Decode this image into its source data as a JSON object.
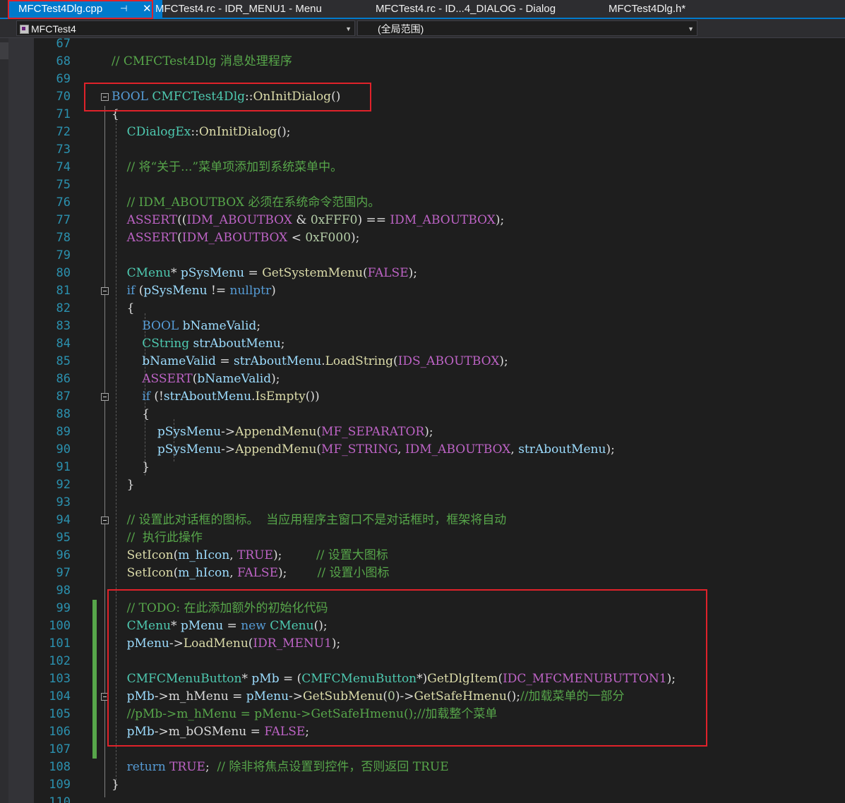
{
  "tabs": [
    {
      "label": "MFCTest4Dlg.cpp",
      "active": true
    },
    {
      "label": "MFCTest4.rc - IDR_MENU1 - Menu"
    },
    {
      "label": "MFCTest4.rc - ID...4_DIALOG - Dialog"
    },
    {
      "label": "MFCTest4Dlg.h*"
    }
  ],
  "tab_pin_icon": "pin-icon",
  "tab_close_icon": "close-icon",
  "project_dropdown": {
    "value": "MFCTest4",
    "icon": "cpp-project-icon"
  },
  "scope_dropdown": {
    "value": "(全局范围)"
  },
  "colors": {
    "accent": "#007acc",
    "highlight_box": "#e0222a",
    "keyword": "#569cd6",
    "type": "#4ec9b0",
    "comment": "#57a64a",
    "function": "#dcdcaa",
    "macro": "#bd63c5",
    "variable": "#9cdcfe",
    "number": "#b5cea8",
    "line_number": "#2b91af",
    "change_bar": "#57a64a"
  },
  "lines": [
    {
      "n": "67",
      "t": [
        [
          "df",
          ""
        ]
      ]
    },
    {
      "n": "68",
      "t": [
        [
          "cm",
          "// CMFCTest4Dlg 消息处理程序"
        ]
      ]
    },
    {
      "n": "69",
      "t": [
        [
          "df",
          ""
        ]
      ]
    },
    {
      "n": "70",
      "t": [
        [
          "kw",
          "BOOL"
        ],
        [
          "df",
          " "
        ],
        [
          "ty",
          "CMFCTest4Dlg"
        ],
        [
          "df",
          "::"
        ],
        [
          "fn",
          "OnInitDialog"
        ],
        [
          "df",
          "()"
        ]
      ]
    },
    {
      "n": "71",
      "t": [
        [
          "df",
          "{"
        ]
      ]
    },
    {
      "n": "72",
      "t": [
        [
          "df",
          "    "
        ],
        [
          "ty",
          "CDialogEx"
        ],
        [
          "df",
          "::"
        ],
        [
          "fn",
          "OnInitDialog"
        ],
        [
          "df",
          "();"
        ]
      ]
    },
    {
      "n": "73",
      "t": [
        [
          "df",
          ""
        ]
      ]
    },
    {
      "n": "74",
      "t": [
        [
          "df",
          "    "
        ],
        [
          "cm",
          "// 将“关于...”菜单项添加到系统菜单中。"
        ]
      ]
    },
    {
      "n": "75",
      "t": [
        [
          "df",
          ""
        ]
      ]
    },
    {
      "n": "76",
      "t": [
        [
          "df",
          "    "
        ],
        [
          "cm",
          "// IDM_ABOUTBOX 必须在系统命令范围内。"
        ]
      ]
    },
    {
      "n": "77",
      "t": [
        [
          "df",
          "    "
        ],
        [
          "mc",
          "ASSERT"
        ],
        [
          "df",
          "(("
        ],
        [
          "mc",
          "IDM_ABOUTBOX"
        ],
        [
          "df",
          " & "
        ],
        [
          "nm",
          "0xFFF0"
        ],
        [
          "df",
          ") == "
        ],
        [
          "mc",
          "IDM_ABOUTBOX"
        ],
        [
          "df",
          ");"
        ]
      ]
    },
    {
      "n": "78",
      "t": [
        [
          "df",
          "    "
        ],
        [
          "mc",
          "ASSERT"
        ],
        [
          "df",
          "("
        ],
        [
          "mc",
          "IDM_ABOUTBOX"
        ],
        [
          "df",
          " < "
        ],
        [
          "nm",
          "0xF000"
        ],
        [
          "df",
          ");"
        ]
      ]
    },
    {
      "n": "79",
      "t": [
        [
          "df",
          ""
        ]
      ]
    },
    {
      "n": "80",
      "t": [
        [
          "df",
          "    "
        ],
        [
          "ty",
          "CMenu"
        ],
        [
          "df",
          "* "
        ],
        [
          "vr",
          "pSysMenu"
        ],
        [
          "df",
          " = "
        ],
        [
          "fn",
          "GetSystemMenu"
        ],
        [
          "df",
          "("
        ],
        [
          "mc",
          "FALSE"
        ],
        [
          "df",
          ");"
        ]
      ]
    },
    {
      "n": "81",
      "t": [
        [
          "df",
          "    "
        ],
        [
          "kw",
          "if"
        ],
        [
          "df",
          " ("
        ],
        [
          "vr",
          "pSysMenu"
        ],
        [
          "df",
          " != "
        ],
        [
          "kw",
          "nullptr"
        ],
        [
          "df",
          ")"
        ]
      ]
    },
    {
      "n": "82",
      "t": [
        [
          "df",
          "    {"
        ]
      ]
    },
    {
      "n": "83",
      "t": [
        [
          "df",
          "        "
        ],
        [
          "kw",
          "BOOL"
        ],
        [
          "df",
          " "
        ],
        [
          "vr",
          "bNameValid"
        ],
        [
          "df",
          ";"
        ]
      ]
    },
    {
      "n": "84",
      "t": [
        [
          "df",
          "        "
        ],
        [
          "ty",
          "CString"
        ],
        [
          "df",
          " "
        ],
        [
          "vr",
          "strAboutMenu"
        ],
        [
          "df",
          ";"
        ]
      ]
    },
    {
      "n": "85",
      "t": [
        [
          "df",
          "        "
        ],
        [
          "vr",
          "bNameValid"
        ],
        [
          "df",
          " = "
        ],
        [
          "vr",
          "strAboutMenu"
        ],
        [
          "df",
          "."
        ],
        [
          "fn",
          "LoadString"
        ],
        [
          "df",
          "("
        ],
        [
          "mc",
          "IDS_ABOUTBOX"
        ],
        [
          "df",
          ");"
        ]
      ]
    },
    {
      "n": "86",
      "t": [
        [
          "df",
          "        "
        ],
        [
          "mc",
          "ASSERT"
        ],
        [
          "df",
          "("
        ],
        [
          "vr",
          "bNameValid"
        ],
        [
          "df",
          ");"
        ]
      ]
    },
    {
      "n": "87",
      "t": [
        [
          "df",
          "        "
        ],
        [
          "kw",
          "if"
        ],
        [
          "df",
          " (!"
        ],
        [
          "vr",
          "strAboutMenu"
        ],
        [
          "df",
          "."
        ],
        [
          "fn",
          "IsEmpty"
        ],
        [
          "df",
          "())"
        ]
      ]
    },
    {
      "n": "88",
      "t": [
        [
          "df",
          "        {"
        ]
      ]
    },
    {
      "n": "89",
      "t": [
        [
          "df",
          "            "
        ],
        [
          "vr",
          "pSysMenu"
        ],
        [
          "df",
          "->"
        ],
        [
          "fn",
          "AppendMenu"
        ],
        [
          "df",
          "("
        ],
        [
          "mc",
          "MF_SEPARATOR"
        ],
        [
          "df",
          ");"
        ]
      ]
    },
    {
      "n": "90",
      "t": [
        [
          "df",
          "            "
        ],
        [
          "vr",
          "pSysMenu"
        ],
        [
          "df",
          "->"
        ],
        [
          "fn",
          "AppendMenu"
        ],
        [
          "df",
          "("
        ],
        [
          "mc",
          "MF_STRING"
        ],
        [
          "df",
          ", "
        ],
        [
          "mc",
          "IDM_ABOUTBOX"
        ],
        [
          "df",
          ", "
        ],
        [
          "vr",
          "strAboutMenu"
        ],
        [
          "df",
          ");"
        ]
      ]
    },
    {
      "n": "91",
      "t": [
        [
          "df",
          "        }"
        ]
      ]
    },
    {
      "n": "92",
      "t": [
        [
          "df",
          "    }"
        ]
      ]
    },
    {
      "n": "93",
      "t": [
        [
          "df",
          ""
        ]
      ]
    },
    {
      "n": "94",
      "t": [
        [
          "df",
          "    "
        ],
        [
          "cm",
          "// 设置此对话框的图标。  当应用程序主窗口不是对话框时，框架将自动"
        ]
      ]
    },
    {
      "n": "95",
      "t": [
        [
          "df",
          "    "
        ],
        [
          "cm",
          "//  执行此操作"
        ]
      ]
    },
    {
      "n": "96",
      "t": [
        [
          "df",
          "    "
        ],
        [
          "fn",
          "SetIcon"
        ],
        [
          "df",
          "("
        ],
        [
          "vr",
          "m_hIcon"
        ],
        [
          "df",
          ", "
        ],
        [
          "mc",
          "TRUE"
        ],
        [
          "df",
          ");         "
        ],
        [
          "cm",
          "// 设置大图标"
        ]
      ]
    },
    {
      "n": "97",
      "t": [
        [
          "df",
          "    "
        ],
        [
          "fn",
          "SetIcon"
        ],
        [
          "df",
          "("
        ],
        [
          "vr",
          "m_hIcon"
        ],
        [
          "df",
          ", "
        ],
        [
          "mc",
          "FALSE"
        ],
        [
          "df",
          ");        "
        ],
        [
          "cm",
          "// 设置小图标"
        ]
      ]
    },
    {
      "n": "98",
      "t": [
        [
          "df",
          ""
        ]
      ]
    },
    {
      "n": "99",
      "t": [
        [
          "df",
          "    "
        ],
        [
          "cm",
          "// TODO: 在此添加额外的初始化代码"
        ]
      ]
    },
    {
      "n": "100",
      "t": [
        [
          "df",
          "    "
        ],
        [
          "ty",
          "CMenu"
        ],
        [
          "df",
          "* "
        ],
        [
          "vr",
          "pMenu"
        ],
        [
          "df",
          " = "
        ],
        [
          "kw",
          "new"
        ],
        [
          "df",
          " "
        ],
        [
          "ty",
          "CMenu"
        ],
        [
          "df",
          "();"
        ]
      ]
    },
    {
      "n": "101",
      "t": [
        [
          "df",
          "    "
        ],
        [
          "vr",
          "pMenu"
        ],
        [
          "df",
          "->"
        ],
        [
          "fn",
          "LoadMenu"
        ],
        [
          "df",
          "("
        ],
        [
          "mc",
          "IDR_MENU1"
        ],
        [
          "df",
          ");"
        ]
      ]
    },
    {
      "n": "102",
      "t": [
        [
          "df",
          ""
        ]
      ]
    },
    {
      "n": "103",
      "t": [
        [
          "df",
          "    "
        ],
        [
          "ty",
          "CMFCMenuButton"
        ],
        [
          "df",
          "* "
        ],
        [
          "vr",
          "pMb"
        ],
        [
          "df",
          " = ("
        ],
        [
          "ty",
          "CMFCMenuButton"
        ],
        [
          "df",
          "*)"
        ],
        [
          "fn",
          "GetDlgItem"
        ],
        [
          "df",
          "("
        ],
        [
          "mc",
          "IDC_MFCMENUBUTTON1"
        ],
        [
          "df",
          ");"
        ]
      ]
    },
    {
      "n": "104",
      "t": [
        [
          "df",
          "    "
        ],
        [
          "vr",
          "pMb"
        ],
        [
          "df",
          "->"
        ],
        [
          "mb",
          "m_hMenu"
        ],
        [
          "df",
          " = "
        ],
        [
          "vr",
          "pMenu"
        ],
        [
          "df",
          "->"
        ],
        [
          "fn",
          "GetSubMenu"
        ],
        [
          "df",
          "("
        ],
        [
          "nm",
          "0"
        ],
        [
          "df",
          ")->"
        ],
        [
          "fn",
          "GetSafeHmenu"
        ],
        [
          "df",
          "();"
        ],
        [
          "cm",
          "//加载菜单的一部分"
        ]
      ]
    },
    {
      "n": "105",
      "t": [
        [
          "df",
          "    "
        ],
        [
          "cm",
          "//pMb->m_hMenu = pMenu->GetSafeHmenu();//加载整个菜单"
        ]
      ]
    },
    {
      "n": "106",
      "t": [
        [
          "df",
          "    "
        ],
        [
          "vr",
          "pMb"
        ],
        [
          "df",
          "->"
        ],
        [
          "mb",
          "m_bOSMenu"
        ],
        [
          "df",
          " = "
        ],
        [
          "mc",
          "FALSE"
        ],
        [
          "df",
          ";"
        ]
      ]
    },
    {
      "n": "107",
      "t": [
        [
          "df",
          ""
        ]
      ]
    },
    {
      "n": "108",
      "t": [
        [
          "df",
          "    "
        ],
        [
          "kw",
          "return"
        ],
        [
          "df",
          " "
        ],
        [
          "mc",
          "TRUE"
        ],
        [
          "df",
          ";  "
        ],
        [
          "cm",
          "// 除非将焦点设置到控件，否则返回 TRUE"
        ]
      ]
    },
    {
      "n": "109",
      "t": [
        [
          "df",
          "}"
        ]
      ]
    },
    {
      "n": "110",
      "t": [
        [
          "df",
          ""
        ]
      ]
    }
  ]
}
